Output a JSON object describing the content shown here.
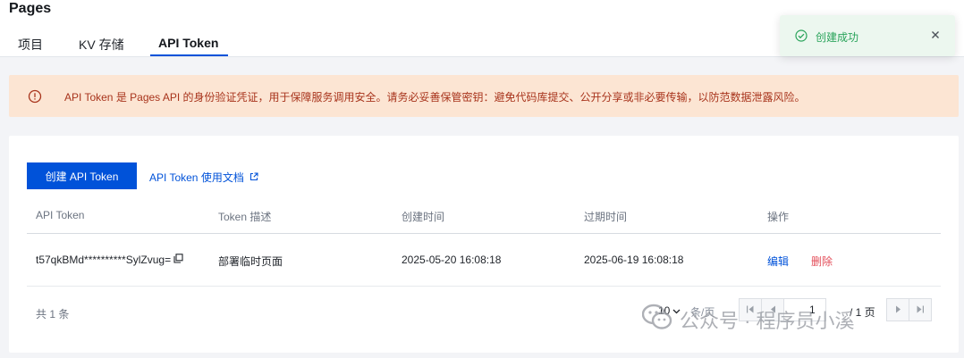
{
  "header": {
    "title": "Pages",
    "tabs": [
      {
        "label": "项目"
      },
      {
        "label": "KV 存储"
      },
      {
        "label": "API Token"
      }
    ]
  },
  "alert": {
    "text": "API Token 是 Pages API 的身份验证凭证，用于保障服务调用安全。请务必妥善保管密钥：避免代码库提交、公开分享或非必要传输，以防范数据泄露风险。",
    "color": "#a8341c",
    "background": "#fce5d3"
  },
  "toolbar": {
    "create_label": "创建 API Token",
    "doc_label": "API Token 使用文档"
  },
  "table": {
    "columns": [
      "API Token",
      "Token 描述",
      "创建时间",
      "过期时间",
      "操作"
    ],
    "rows": [
      {
        "token": "t57qkBMd**********SylZvug=",
        "description": "部署临时页面",
        "created": "2025-05-20 16:08:18",
        "expires": "2025-06-19 16:08:18",
        "edit": "编辑",
        "delete": "删除"
      }
    ]
  },
  "pagination": {
    "total": "共 1 条",
    "page_size": "10",
    "per_page_label": "条/页",
    "current_page": "1",
    "total_pages": "/ 1 页"
  },
  "toast": {
    "text": "创建成功",
    "color": "#29a35a"
  },
  "watermark": {
    "text": "公众号 · 程序员小溪"
  },
  "colors": {
    "brand": "#0052d9",
    "danger": "#e34d59"
  }
}
